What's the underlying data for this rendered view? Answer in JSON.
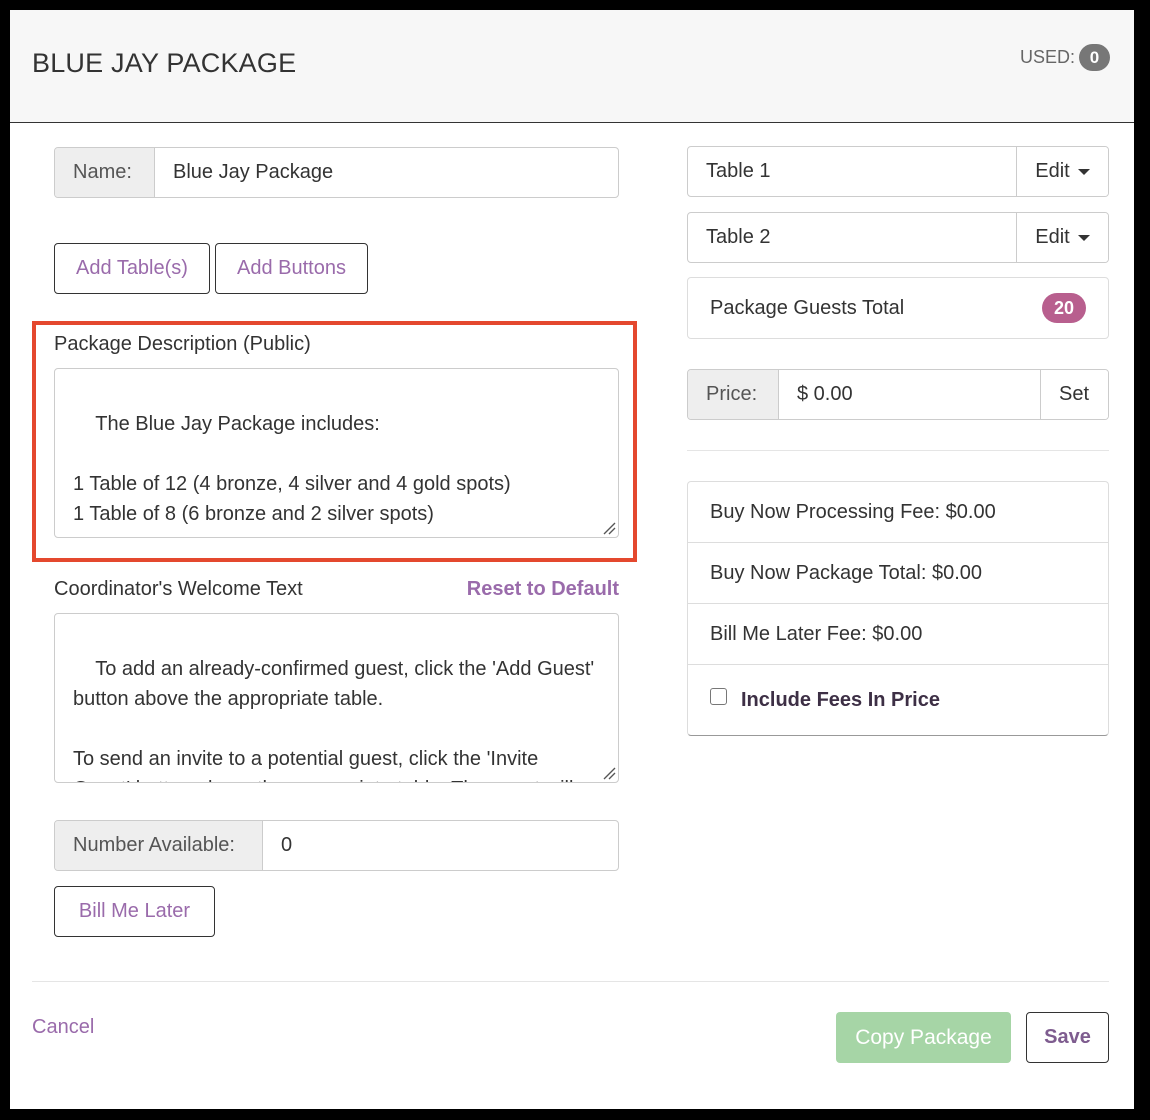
{
  "header": {
    "title": "BLUE JAY PACKAGE",
    "used_label": "USED:",
    "used_count": "0"
  },
  "left": {
    "name_label": "Name:",
    "name_value": "Blue Jay Package",
    "add_tables_label": "Add Table(s)",
    "add_buttons_label": "Add Buttons",
    "description_label": "Package Description (Public)",
    "description_text": "The Blue Jay Package includes:\n\n1 Table of 12 (4 bronze, 4 silver and 4 gold spots)\n1 Table of 8 (6 bronze and 2 silver spots)",
    "welcome_label": "Coordinator's Welcome Text",
    "reset_label": "Reset to Default",
    "welcome_text": "To add an already-confirmed guest, click the 'Add Guest' button above the appropriate table.\n\nTo send an invite to a potential guest, click the 'Invite Guest' button above the appropriate table. The guest will receive an invite email for you to track invite status.",
    "number_available_label": "Number Available:",
    "number_available_value": "0",
    "bill_me_later_label": "Bill Me Later"
  },
  "right": {
    "tables": [
      {
        "name": "Table 1",
        "edit_label": "Edit"
      },
      {
        "name": "Table 2",
        "edit_label": "Edit"
      }
    ],
    "guests_total_label": "Package Guests Total",
    "guests_total_value": "20",
    "price_label": "Price:",
    "price_value": "$ 0.00",
    "set_label": "Set",
    "fees": {
      "processing_fee": "Buy Now Processing Fee: $0.00",
      "package_total": "Buy Now Package Total: $0.00",
      "bill_later_fee": "Bill Me Later Fee: $0.00",
      "include_fees_label": "Include Fees In Price",
      "include_fees_checked": false
    }
  },
  "footer": {
    "cancel_label": "Cancel",
    "copy_label": "Copy Package",
    "save_label": "Save"
  },
  "colors": {
    "accent": "#9a6bab",
    "highlight": "#e4482e",
    "badge": "#b85f8e",
    "copy_button": "#a6d5a6"
  }
}
